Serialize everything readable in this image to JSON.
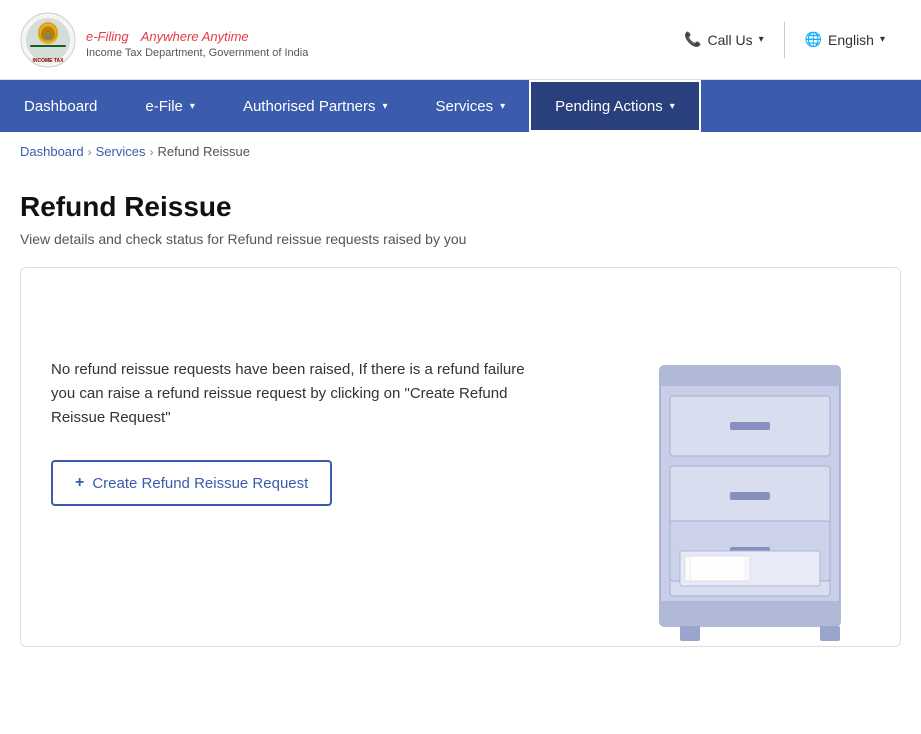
{
  "header": {
    "logo_title_main": "e-Filing",
    "logo_title_tagline": "Anywhere Anytime",
    "logo_subtitle": "Income Tax Department, Government of India",
    "call_us_label": "Call Us",
    "language_label": "English"
  },
  "navbar": {
    "items": [
      {
        "id": "dashboard",
        "label": "Dashboard",
        "has_dropdown": false,
        "active": false
      },
      {
        "id": "efile",
        "label": "e-File",
        "has_dropdown": true,
        "active": false
      },
      {
        "id": "authorised-partners",
        "label": "Authorised Partners",
        "has_dropdown": true,
        "active": false
      },
      {
        "id": "services",
        "label": "Services",
        "has_dropdown": true,
        "active": false
      },
      {
        "id": "pending-actions",
        "label": "Pending Actions",
        "has_dropdown": true,
        "active": true
      }
    ]
  },
  "breadcrumb": {
    "items": [
      {
        "label": "Dashboard",
        "link": true
      },
      {
        "label": "Services",
        "link": true
      },
      {
        "label": "Refund Reissue",
        "link": false
      }
    ]
  },
  "main": {
    "title": "Refund Reissue",
    "subtitle": "View details and check status for Refund reissue requests raised by you",
    "card": {
      "empty_message": "No refund reissue requests have been raised, If there is a refund failure you can raise a refund reissue request by clicking on \"Create Refund Reissue Request\"",
      "create_button_label": "Create Refund Reissue Request"
    }
  }
}
